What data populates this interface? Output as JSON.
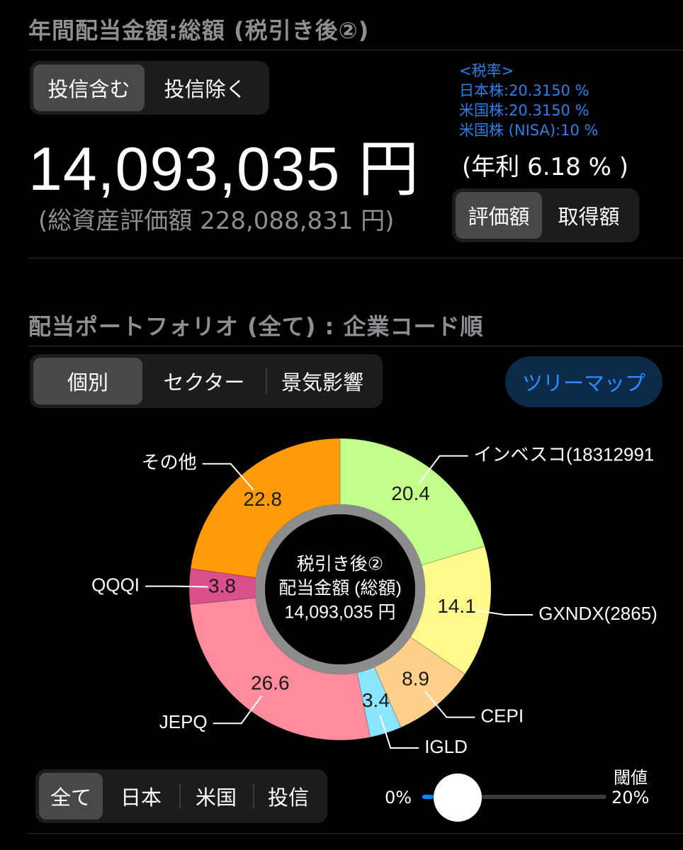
{
  "header": {
    "title": "年間配当金額:総額 (税引き後②)"
  },
  "fund_toggle": {
    "options": [
      "投信含む",
      "投信除く"
    ],
    "selected": "投信含む"
  },
  "summary": {
    "total": "14,093,035 円",
    "asset_text": "(総資産評価額 228,088,831 円)",
    "yield_text": "(年利 6.18 % )"
  },
  "tax_rates": {
    "title": "<税率>",
    "jp": "日本株:20.3150 %",
    "us": "米国株:20.3150 %",
    "nisa": "米国株 (NISA):10 %"
  },
  "basis_toggle": {
    "options": [
      "評価額",
      "取得額"
    ],
    "selected": "評価額"
  },
  "portfolio": {
    "title": "配当ポートフォリオ (全て) : 企業コード順",
    "tabs": [
      "個別",
      "セクター",
      "景気影響"
    ],
    "selected_tab": "個別",
    "treemap_button": "ツリーマップ"
  },
  "chart_data": {
    "type": "pie",
    "donut": true,
    "start": "top, clockwise",
    "center_text": [
      "税引き後②",
      "配当金額 (総額)",
      "14,093,035 円"
    ],
    "slices": [
      {
        "label": "インベスコ(18312991",
        "value": 20.4,
        "color": "#c3fd8c"
      },
      {
        "label": "GXNDX(2865)",
        "value": 14.1,
        "color": "#fff98c"
      },
      {
        "label": "CEPI",
        "value": 8.9,
        "color": "#ffd08c"
      },
      {
        "label": "IGLD",
        "value": 3.4,
        "color": "#8ce5ff"
      },
      {
        "label": "JEPQ",
        "value": 26.6,
        "color": "#ff8c9c"
      },
      {
        "label": "QQQI",
        "value": 3.8,
        "color": "#d9508c"
      },
      {
        "label": "その他",
        "value": 22.8,
        "color": "#ff9a0a"
      }
    ]
  },
  "region_filter": {
    "options": [
      "全て",
      "日本",
      "米国",
      "投信"
    ],
    "selected": "全て"
  },
  "threshold": {
    "label": "閾値",
    "min_label": "0%",
    "max_label": "20%",
    "value_fraction": 0.06
  }
}
